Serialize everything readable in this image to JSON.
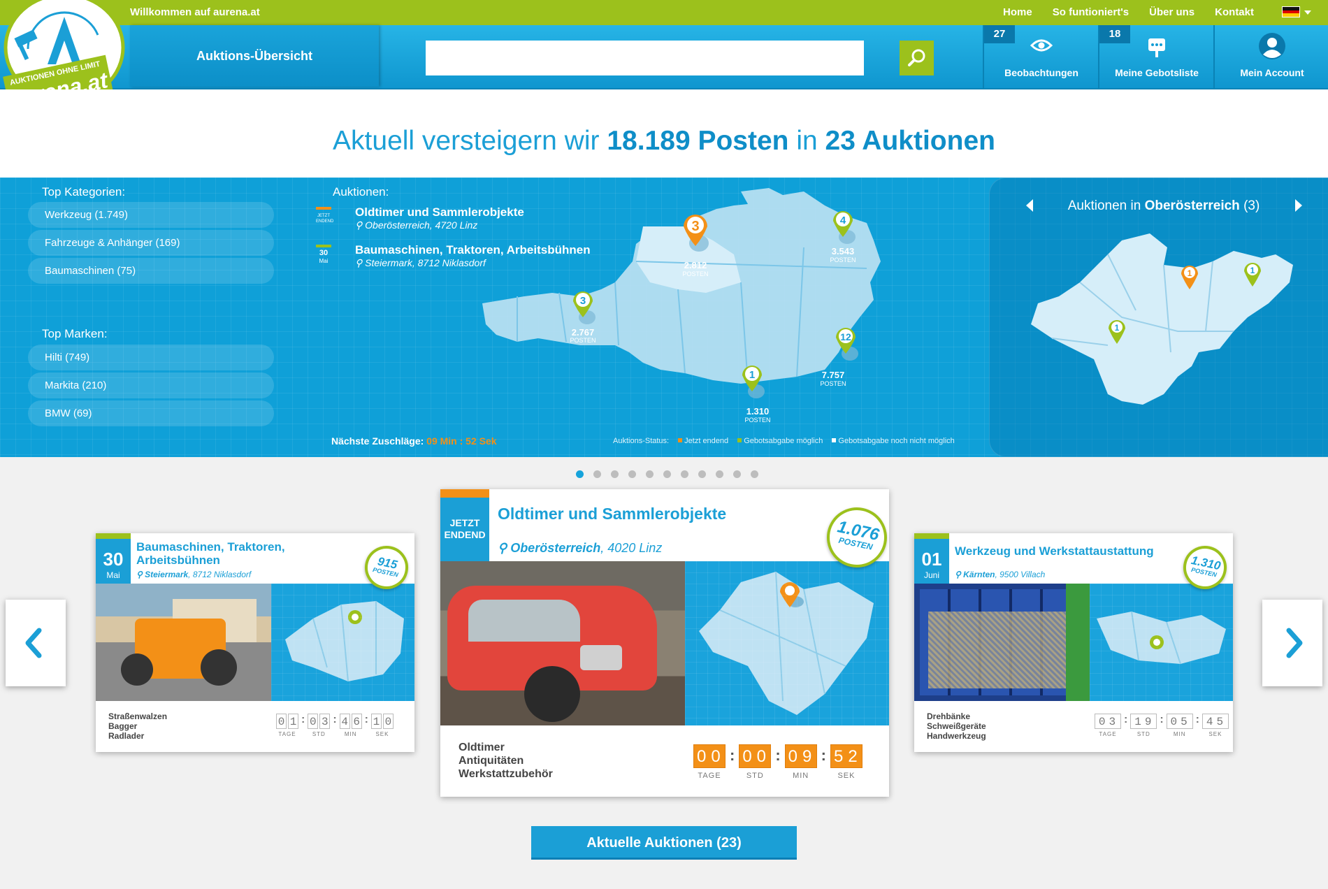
{
  "topbar": {
    "welcome": "Willkommen auf aurena.at",
    "nav": [
      "Home",
      "So funtioniert's",
      "Über uns",
      "Kontakt"
    ],
    "language": "german-flag"
  },
  "logo": {
    "brand": "aurena.at",
    "tagline": "AUKTIONEN OHNE LIMIT"
  },
  "header": {
    "overview_label": "Auktions-Übersicht",
    "search_placeholder": "",
    "watch": {
      "label": "Beobachtungen",
      "count": "27"
    },
    "bids": {
      "label": "Meine Gebotsliste",
      "count": "18"
    },
    "account": {
      "label": "Mein Account"
    }
  },
  "headline": {
    "pre": "Aktuell versteigern wir ",
    "posten": "18.189 Posten",
    "mid": " in ",
    "auktionen": "23 Auktionen"
  },
  "categories": {
    "title": "Top Kategorien:",
    "items": [
      "Werkzeug (1.749)",
      "Fahrzeuge & Anhänger (169)",
      "Baumaschinen (75)"
    ]
  },
  "brands": {
    "title": "Top Marken:",
    "items": [
      "Hilti (749)",
      "Markita (210)",
      "BMW (69)"
    ]
  },
  "auctions_list": {
    "title": "Auktionen:",
    "items": [
      {
        "tag": "JETZT ENDEND",
        "title": "Oldtimer und Sammlerobjekte",
        "location": "Oberösterreich, 4720 Linz"
      },
      {
        "tag_day": "30",
        "tag_month": "Mai",
        "title": "Baumaschinen, Traktoren, Arbeitsbühnen",
        "location": "Steiermark, 8712 Niklasdorf"
      }
    ]
  },
  "map_pins": [
    {
      "count": "3",
      "posten": "2.812",
      "unit": "POSTEN",
      "status": "ending"
    },
    {
      "count": "4",
      "posten": "3.543",
      "unit": "POSTEN",
      "status": "open"
    },
    {
      "count": "3",
      "posten": "2.767",
      "unit": "POSTEN",
      "status": "open"
    },
    {
      "count": "12",
      "posten": "7.757",
      "unit": "POSTEN",
      "status": "open"
    },
    {
      "count": "1",
      "posten": "1.310",
      "unit": "POSTEN",
      "status": "open"
    }
  ],
  "next_bids": {
    "label": "Nächste Zuschläge: ",
    "value": "09 Min : 52 Sek"
  },
  "status_legend": {
    "label": "Auktions-Status:",
    "items": [
      {
        "label": "Jetzt endend",
        "color": "#f39017"
      },
      {
        "label": "Gebotsabgabe möglich",
        "color": "#9cc11c"
      },
      {
        "label": "Gebotsabgabe noch nicht möglich",
        "color": "#ffffff"
      }
    ]
  },
  "region": {
    "prefix": "Auktionen in ",
    "name": "Oberösterreich",
    "count": " (3)",
    "pins": [
      "1",
      "1",
      "1"
    ]
  },
  "carousel_dots": 11,
  "cards": {
    "left": {
      "day": "30",
      "month": "Mai",
      "title": "Baumaschinen, Traktoren, Arbeitsbühnen",
      "region": "Steiermark",
      "place": ", 8712 Niklasdorf",
      "badge_num": "915",
      "badge_unit": "POSTEN",
      "cats": [
        "Straßenwalzen",
        "Bagger",
        "Radlader"
      ],
      "timer": [
        "01",
        "03",
        "46",
        "10"
      ]
    },
    "center": {
      "tag": "JETZT ENDEND",
      "title": "Oldtimer und Sammlerobjekte",
      "region": "Oberösterreich",
      "place": ", 4020 Linz",
      "badge_num": "1.076",
      "badge_unit": "POSTEN",
      "cats": [
        "Oldtimer",
        "Antiquitäten",
        "Werkstattzubehör"
      ],
      "timer": [
        "00",
        "00",
        "09",
        "52"
      ]
    },
    "right": {
      "day": "01",
      "month": "Juni",
      "title": "Werkzeug und Werkstattaustattung",
      "region": "Kärnten",
      "place": ", 9500 Villach",
      "badge_num": "1.310",
      "badge_unit": "POSTEN",
      "cats": [
        "Drehbänke",
        "Schweißgeräte",
        "Handwerkzeug"
      ],
      "timer": [
        "03",
        "19",
        "05",
        "45"
      ]
    }
  },
  "timer_units": [
    "TAGE",
    "STD",
    "MIN",
    "SEK"
  ],
  "cta": {
    "label": "Aktuelle Auktionen (23)"
  },
  "colors": {
    "brand_green": "#9cc11c",
    "brand_blue": "#1b9fd6",
    "ending_orange": "#f39017"
  }
}
